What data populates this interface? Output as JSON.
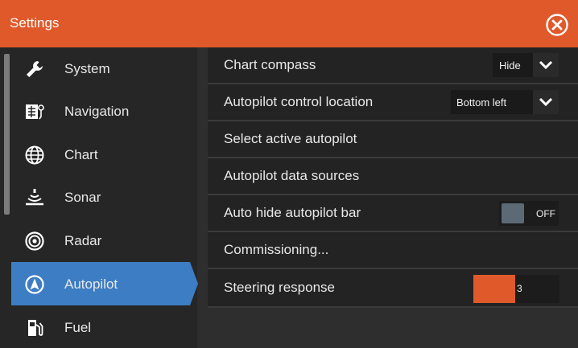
{
  "window": {
    "title": "Settings"
  },
  "colors": {
    "accent": "#e0592b",
    "selected": "#3d7dc4",
    "toggle_knob": "#5c6a76"
  },
  "sidebar": {
    "items": [
      {
        "label": "System",
        "icon": "wrench-icon"
      },
      {
        "label": "Navigation",
        "icon": "navigation-icon"
      },
      {
        "label": "Chart",
        "icon": "globe-icon"
      },
      {
        "label": "Sonar",
        "icon": "sonar-icon"
      },
      {
        "label": "Radar",
        "icon": "radar-icon"
      },
      {
        "label": "Autopilot",
        "icon": "autopilot-icon",
        "selected": true
      },
      {
        "label": "Fuel",
        "icon": "fuel-icon"
      }
    ]
  },
  "settings": {
    "chart_compass": {
      "label": "Chart compass",
      "value": "Hide"
    },
    "autopilot_control_location": {
      "label": "Autopilot control location",
      "value": "Bottom left"
    },
    "select_active_autopilot": {
      "label": "Select active autopilot"
    },
    "autopilot_data_sources": {
      "label": "Autopilot data sources"
    },
    "auto_hide_autopilot_bar": {
      "label": "Auto hide autopilot bar",
      "value": "OFF"
    },
    "commissioning": {
      "label": "Commissioning..."
    },
    "steering_response": {
      "label": "Steering response",
      "value": "3",
      "fill_fraction": 0.49
    }
  }
}
